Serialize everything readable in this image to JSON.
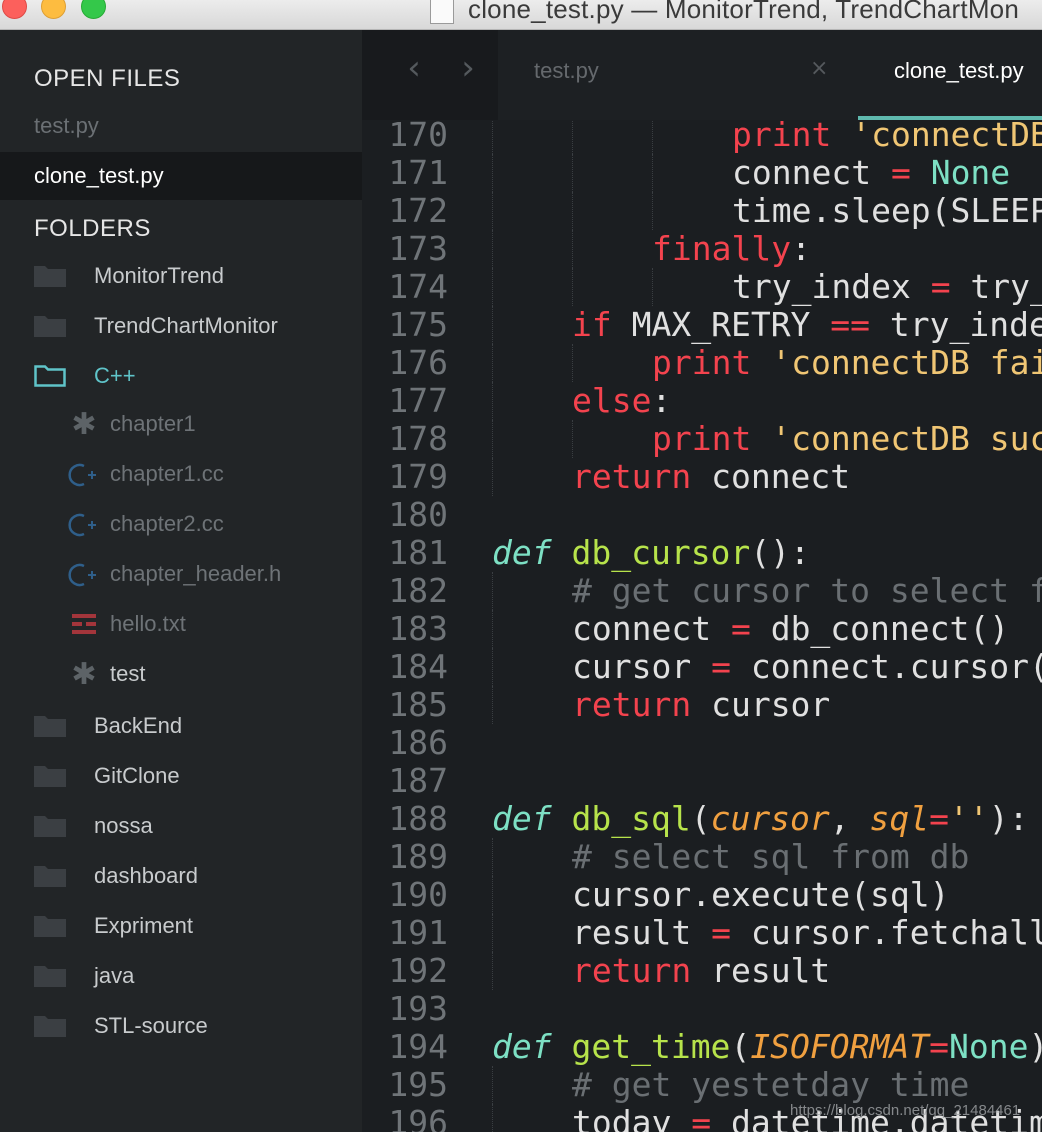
{
  "window": {
    "title": "clone_test.py — MonitorTrend, TrendChartMon"
  },
  "sidebar": {
    "open_files_header": "OPEN FILES",
    "open_files": [
      {
        "name": "test.py",
        "active": false
      },
      {
        "name": "clone_test.py",
        "active": true
      }
    ],
    "folders_header": "FOLDERS",
    "folders_top": [
      {
        "name": "MonitorTrend",
        "icon": "folder-icon"
      },
      {
        "name": "TrendChartMonitor",
        "icon": "folder-icon"
      },
      {
        "name": "C++",
        "icon": "folder-open-icon"
      }
    ],
    "cpp_children": [
      {
        "name": "chapter1",
        "icon": "asterisk-icon"
      },
      {
        "name": "chapter1.cc",
        "icon": "cpp-file-icon"
      },
      {
        "name": "chapter2.cc",
        "icon": "cpp-file-icon"
      },
      {
        "name": "chapter_header.h",
        "icon": "cpp-file-icon"
      },
      {
        "name": "hello.txt",
        "icon": "text-file-icon"
      },
      {
        "name": "test",
        "icon": "asterisk-icon"
      }
    ],
    "folders_bottom": [
      {
        "name": "BackEnd"
      },
      {
        "name": "GitClone"
      },
      {
        "name": "nossa"
      },
      {
        "name": "dashboard"
      },
      {
        "name": "Expriment"
      },
      {
        "name": "java"
      },
      {
        "name": "STL-source"
      }
    ]
  },
  "tabs": [
    {
      "label": "test.py",
      "active": false,
      "close": "×"
    },
    {
      "label": "clone_test.py",
      "active": true
    }
  ],
  "nav": {
    "back": "‹",
    "forward": "›"
  },
  "editor": {
    "lines": [
      {
        "n": "170",
        "tokens": [
          [
            "kw",
            "print "
          ],
          [
            "str",
            "'connectDB"
          ]
        ]
      },
      {
        "n": "171",
        "tokens": [
          [
            "plain",
            "connect "
          ],
          [
            "op",
            "="
          ],
          [
            "const",
            " None"
          ]
        ]
      },
      {
        "n": "172",
        "tokens": [
          [
            "plain",
            "time.sleep(SLEEP"
          ]
        ]
      },
      {
        "n": "173",
        "tokens": [
          [
            "kw",
            "finally"
          ],
          [
            "plain",
            ":"
          ]
        ]
      },
      {
        "n": "174",
        "tokens": [
          [
            "plain",
            "try_index "
          ],
          [
            "op",
            "="
          ],
          [
            "plain",
            " try_"
          ]
        ]
      },
      {
        "n": "175",
        "tokens": [
          [
            "kw",
            "if"
          ],
          [
            "plain",
            " MAX_RETRY "
          ],
          [
            "op",
            "=="
          ],
          [
            "plain",
            " try_inde"
          ]
        ]
      },
      {
        "n": "176",
        "tokens": [
          [
            "kw",
            "print "
          ],
          [
            "str",
            "'connectDB fai"
          ]
        ]
      },
      {
        "n": "177",
        "tokens": [
          [
            "kw",
            "else"
          ],
          [
            "plain",
            ":"
          ]
        ]
      },
      {
        "n": "178",
        "tokens": [
          [
            "kw",
            "print "
          ],
          [
            "str",
            "'connectDB suc"
          ]
        ]
      },
      {
        "n": "179",
        "tokens": [
          [
            "kw",
            "return"
          ],
          [
            "plain",
            " connect"
          ]
        ]
      },
      {
        "n": "180",
        "tokens": []
      },
      {
        "n": "181",
        "tokens": [
          [
            "def",
            "def"
          ],
          [
            "plain",
            " "
          ],
          [
            "fn",
            "db_cursor"
          ],
          [
            "plain",
            "():"
          ]
        ]
      },
      {
        "n": "182",
        "tokens": [
          [
            "cmt",
            "# get cursor to select f"
          ]
        ]
      },
      {
        "n": "183",
        "tokens": [
          [
            "plain",
            "connect "
          ],
          [
            "op",
            "="
          ],
          [
            "plain",
            " db_connect()"
          ]
        ]
      },
      {
        "n": "184",
        "tokens": [
          [
            "plain",
            "cursor "
          ],
          [
            "op",
            "="
          ],
          [
            "plain",
            " connect.cursor("
          ]
        ]
      },
      {
        "n": "185",
        "tokens": [
          [
            "kw",
            "return"
          ],
          [
            "plain",
            " cursor"
          ]
        ]
      },
      {
        "n": "186",
        "tokens": []
      },
      {
        "n": "187",
        "tokens": []
      },
      {
        "n": "188",
        "tokens": [
          [
            "def",
            "def"
          ],
          [
            "plain",
            " "
          ],
          [
            "fn",
            "db_sql"
          ],
          [
            "plain",
            "("
          ],
          [
            "param",
            "cursor"
          ],
          [
            "plain",
            ", "
          ],
          [
            "param",
            "sql"
          ],
          [
            "op",
            "="
          ],
          [
            "str",
            "''"
          ],
          [
            "plain",
            "):"
          ]
        ]
      },
      {
        "n": "189",
        "tokens": [
          [
            "cmt",
            "# select sql from db"
          ]
        ]
      },
      {
        "n": "190",
        "tokens": [
          [
            "plain",
            "cursor.execute(sql)"
          ]
        ]
      },
      {
        "n": "191",
        "tokens": [
          [
            "plain",
            "result "
          ],
          [
            "op",
            "="
          ],
          [
            "plain",
            " cursor.fetchall"
          ]
        ]
      },
      {
        "n": "192",
        "tokens": [
          [
            "kw",
            "return"
          ],
          [
            "plain",
            " result"
          ]
        ]
      },
      {
        "n": "193",
        "tokens": []
      },
      {
        "n": "194",
        "tokens": [
          [
            "def",
            "def"
          ],
          [
            "plain",
            " "
          ],
          [
            "fn",
            "get_time"
          ],
          [
            "plain",
            "("
          ],
          [
            "param",
            "ISOFORMAT"
          ],
          [
            "op",
            "="
          ],
          [
            "const",
            "None"
          ],
          [
            "plain",
            ")"
          ]
        ]
      },
      {
        "n": "195",
        "tokens": [
          [
            "cmt",
            "# get yestetday time"
          ]
        ]
      },
      {
        "n": "196",
        "tokens": [
          [
            "plain",
            "today "
          ],
          [
            "op",
            "="
          ],
          [
            "plain",
            " datetime.datetim"
          ]
        ]
      }
    ]
  },
  "watermark": "https://blog.csdn.net/qq_21484461",
  "colors": {
    "accent": "#5fb9ae",
    "keyword": "#f3434e",
    "function": "#b7e34b",
    "string": "#f0c674"
  }
}
